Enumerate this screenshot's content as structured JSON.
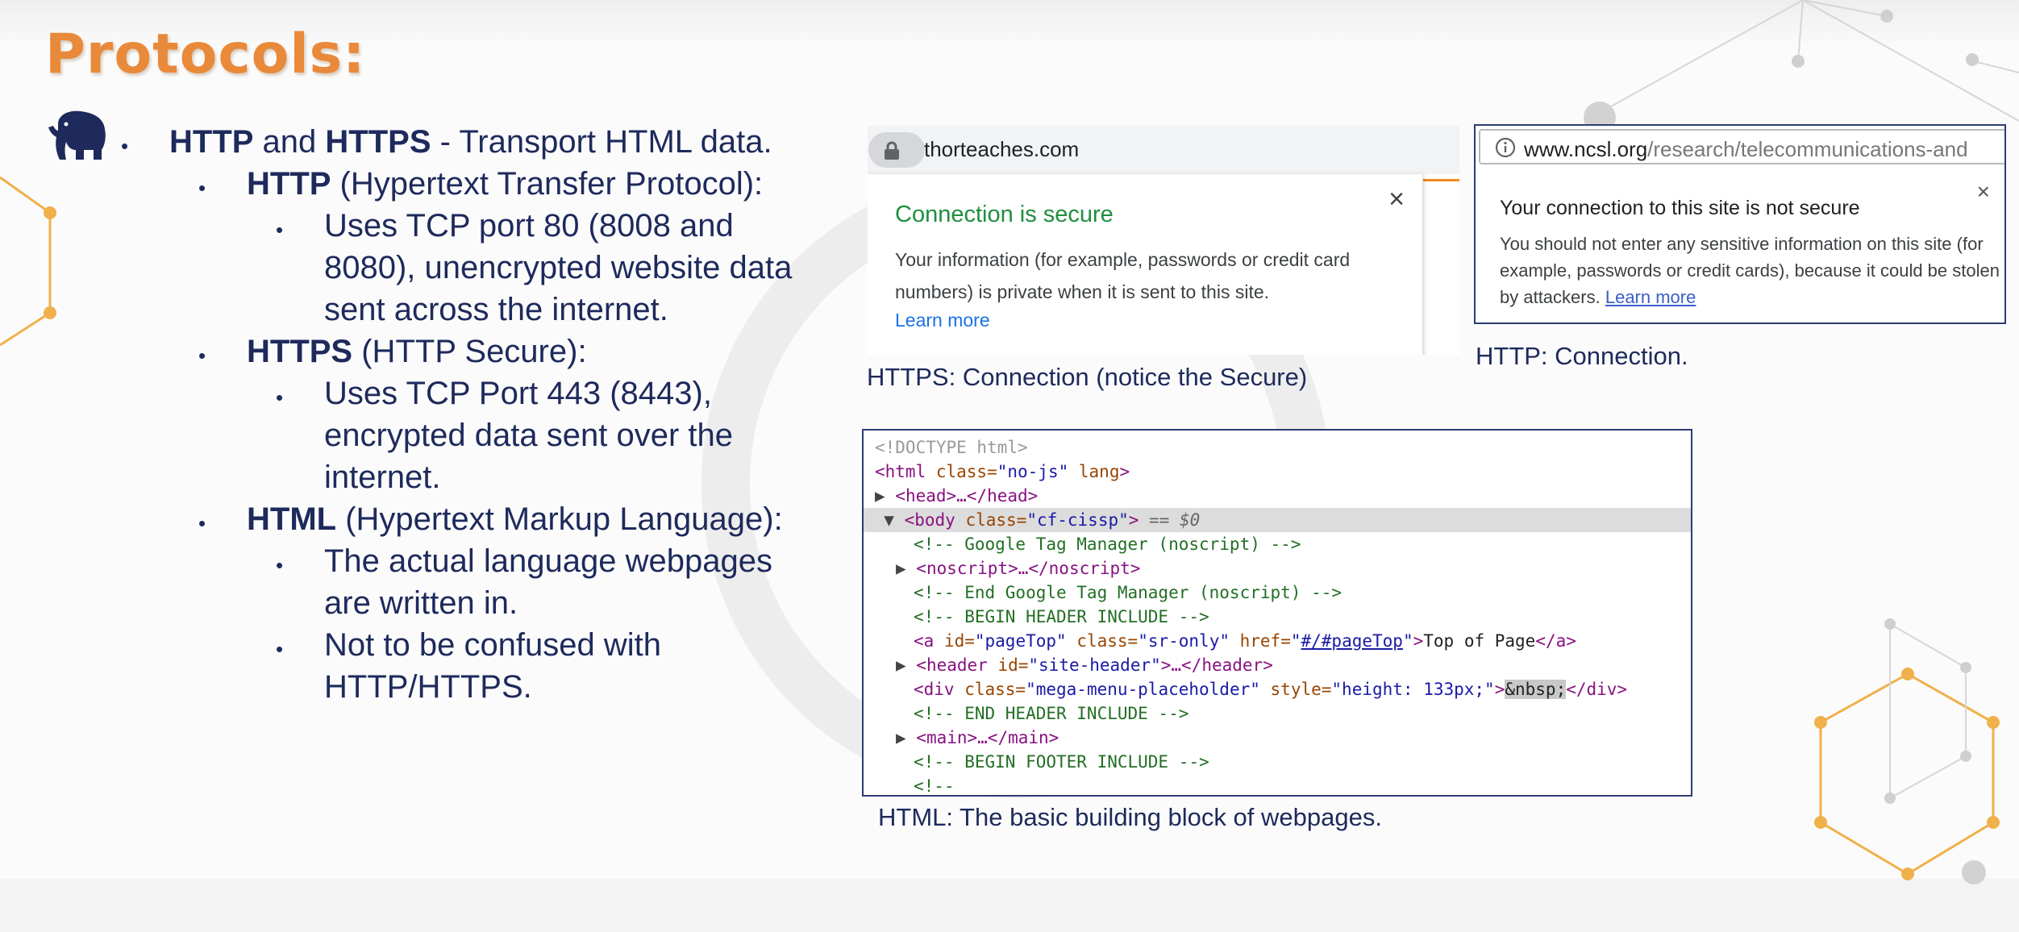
{
  "slide": {
    "title": "Protocols:",
    "colors": {
      "title": "#e9893a",
      "text": "#1e2a5c",
      "accent_gold": "#f0b04a"
    }
  },
  "bullets": [
    {
      "level": 1,
      "bold": "HTTP",
      "mid_text": " and ",
      "bold2": "HTTPS",
      "rest": " - Transport HTML data."
    },
    {
      "level": 2,
      "bold": "HTTP",
      "rest": " (Hypertext Transfer Protocol):"
    },
    {
      "level": 3,
      "lines": [
        "Uses TCP port 80 (8008 and",
        "8080), unencrypted website data",
        "sent across the internet."
      ]
    },
    {
      "level": 2,
      "bold": "HTTPS",
      "rest": " (HTTP Secure):"
    },
    {
      "level": 3,
      "lines": [
        "Uses TCP Port 443 (8443),",
        "encrypted data sent over the",
        "internet."
      ]
    },
    {
      "level": 2,
      "bold": "HTML",
      "rest": " (Hypertext Markup Language):"
    },
    {
      "level": 3,
      "lines": [
        "The actual language webpages",
        "are written in."
      ]
    },
    {
      "level": 3,
      "lines": [
        "Not to be confused with",
        "HTTP/HTTPS."
      ]
    }
  ],
  "https_screenshot": {
    "url": "thorteaches.com",
    "popup_title": "Connection is secure",
    "popup_body": "Your information (for example, passwords or credit card numbers) is private when it is sent to this site.",
    "learn_more": "Learn more",
    "close": "×",
    "caption": "HTTPS: Connection (notice the  Secure)",
    "icon": "lock-icon"
  },
  "http_screenshot": {
    "url_domain": "www.ncsl.org",
    "url_path": "/research/telecommunications-and",
    "popup_title": "Your connection to this site is not secure",
    "popup_body": "You should not enter any sensitive information on this site (for example, passwords or credit cards), because it could be stolen by attackers.",
    "learn_more": "Learn more",
    "close": "×",
    "caption": "HTTP: Connection.",
    "icon": "info-icon"
  },
  "code_screenshot": {
    "caption": "HTML: The basic building block of webpages.",
    "lines": {
      "doctype": "<!DOCTYPE html>",
      "html_open_tag": "<html",
      "html_attr": " class=",
      "html_val": "\"no-js\"",
      "html_attr2": " lang",
      "html_close": ">",
      "head": "<head>…</head>",
      "body_open": "<body",
      "body_attr": " class=",
      "body_val": "\"cf-cissp\"",
      "body_close": ">",
      "body_eq": " == $0",
      "cmt1": "<!-- Google Tag Manager (noscript) -->",
      "noscript": "<noscript>…</noscript>",
      "cmt2": "<!-- End Google Tag Manager (noscript) -->",
      "cmt3": "<!-- BEGIN HEADER INCLUDE -->",
      "a_open": "<a",
      "a_attr1": " id=",
      "a_val1": "\"pageTop\"",
      "a_attr2": " class=",
      "a_val2": "\"sr-only\"",
      "a_attr3": " href=",
      "a_q1": "\"",
      "a_link": "#/#pageTop",
      "a_q2": "\"",
      "a_gt": ">",
      "a_text": "Top of Page",
      "a_close": "</a>",
      "header_open": "<header",
      "header_attr": " id=",
      "header_val": "\"site-header\"",
      "header_rest": ">…</header>",
      "div_open": "<div",
      "div_attr1": " class=",
      "div_val1": "\"mega-menu-placeholder\"",
      "div_attr2": " style=",
      "div_val2": "\"height: 133px;\"",
      "div_gt": ">",
      "div_ent": "&nbsp;",
      "div_close": "</div>",
      "cmt4": "<!-- END HEADER INCLUDE -->",
      "main": "<main>…</main>",
      "cmt5": "<!-- BEGIN FOOTER INCLUDE -->",
      "cmt6": "<!--"
    }
  }
}
